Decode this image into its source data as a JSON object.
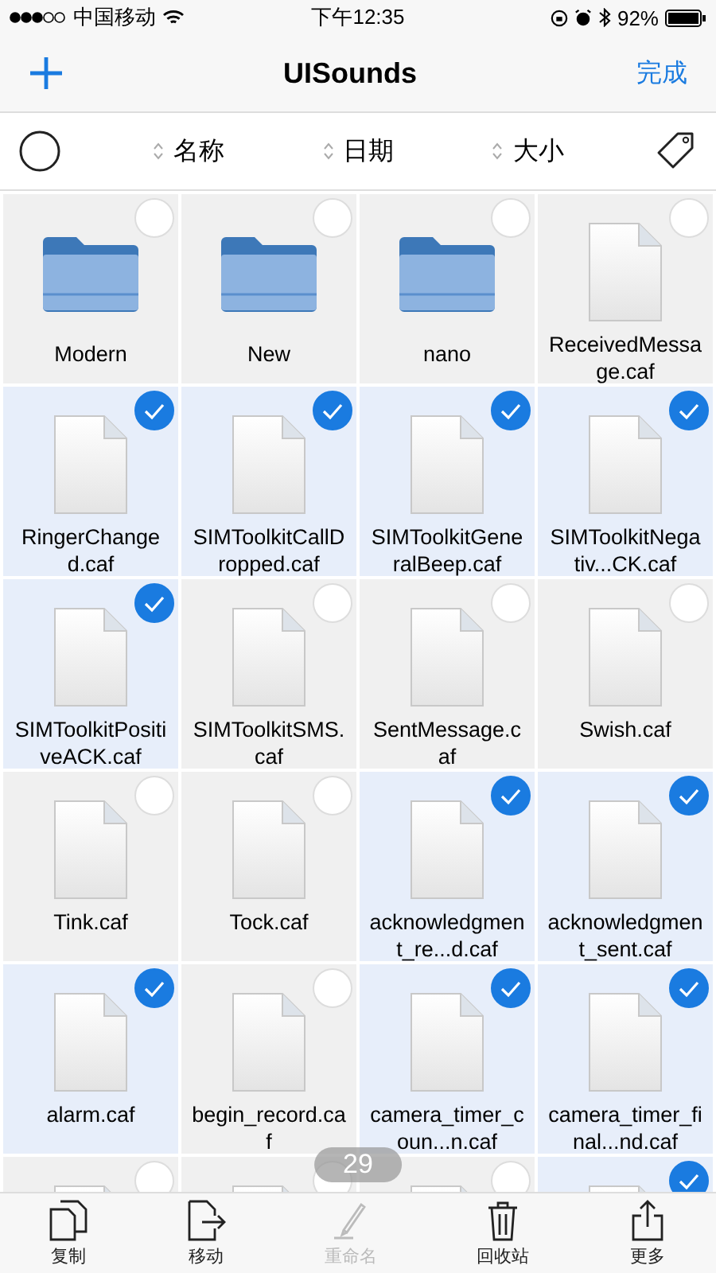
{
  "status_bar": {
    "carrier": "中国移动",
    "time": "下午12:35",
    "battery": "92%"
  },
  "nav": {
    "title": "UISounds",
    "done": "完成"
  },
  "sort_bar": {
    "select_all": {
      "checked": false
    },
    "columns": [
      {
        "label": "名称"
      },
      {
        "label": "日期"
      },
      {
        "label": "大小"
      }
    ]
  },
  "files": [
    {
      "kind": "folder",
      "name": "Modern",
      "selected": false
    },
    {
      "kind": "folder",
      "name": "New",
      "selected": false
    },
    {
      "kind": "folder",
      "name": "nano",
      "selected": false
    },
    {
      "kind": "file",
      "name": "ReceivedMessage.caf",
      "selected": false
    },
    {
      "kind": "file",
      "name": "RingerChanged.caf",
      "selected": true
    },
    {
      "kind": "file",
      "name": "SIMToolkitCallDropped.caf",
      "selected": true
    },
    {
      "kind": "file",
      "name": "SIMToolkitGeneralBeep.caf",
      "selected": true
    },
    {
      "kind": "file",
      "name": "SIMToolkitNegativ...CK.caf",
      "selected": true
    },
    {
      "kind": "file",
      "name": "SIMToolkitPositiveACK.caf",
      "selected": true
    },
    {
      "kind": "file",
      "name": "SIMToolkitSMS.caf",
      "selected": false
    },
    {
      "kind": "file",
      "name": "SentMessage.caf",
      "selected": false
    },
    {
      "kind": "file",
      "name": "Swish.caf",
      "selected": false
    },
    {
      "kind": "file",
      "name": "Tink.caf",
      "selected": false
    },
    {
      "kind": "file",
      "name": "Tock.caf",
      "selected": false
    },
    {
      "kind": "file",
      "name": "acknowledgment_re...d.caf",
      "selected": true
    },
    {
      "kind": "file",
      "name": "acknowledgment_sent.caf",
      "selected": true
    },
    {
      "kind": "file",
      "name": "alarm.caf",
      "selected": true
    },
    {
      "kind": "file",
      "name": "begin_record.caf",
      "selected": false
    },
    {
      "kind": "file",
      "name": "camera_timer_coun...n.caf",
      "selected": true
    },
    {
      "kind": "file",
      "name": "camera_timer_final...nd.caf",
      "selected": true
    },
    {
      "kind": "file",
      "selected": false
    },
    {
      "kind": "file",
      "selected": false
    },
    {
      "kind": "file",
      "selected": false
    },
    {
      "kind": "file",
      "selected": true
    }
  ],
  "selected_count": "29",
  "toolbar": [
    {
      "kind": "copy",
      "label": "复制",
      "disabled": false
    },
    {
      "kind": "move",
      "label": "移动",
      "disabled": false
    },
    {
      "kind": "rename",
      "label": "重命名",
      "disabled": true
    },
    {
      "kind": "trash",
      "label": "回收站",
      "disabled": false
    },
    {
      "kind": "share",
      "label": "更多",
      "disabled": false
    }
  ]
}
